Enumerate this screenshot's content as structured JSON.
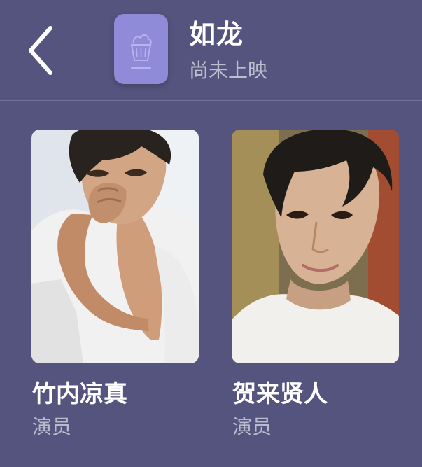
{
  "header": {
    "title": "如龙",
    "subtitle": "尚未上映",
    "back_icon": "chevron-left-icon",
    "poster_placeholder_icon": "popcorn-icon"
  },
  "cast": [
    {
      "name": "竹内凉真",
      "role": "演员"
    },
    {
      "name": "贺来贤人",
      "role": "演员"
    }
  ],
  "colors": {
    "background": "#55547f",
    "poster_tile": "#8f8bd8",
    "text_primary": "#ffffff",
    "text_secondary": "#b8b7cd"
  }
}
